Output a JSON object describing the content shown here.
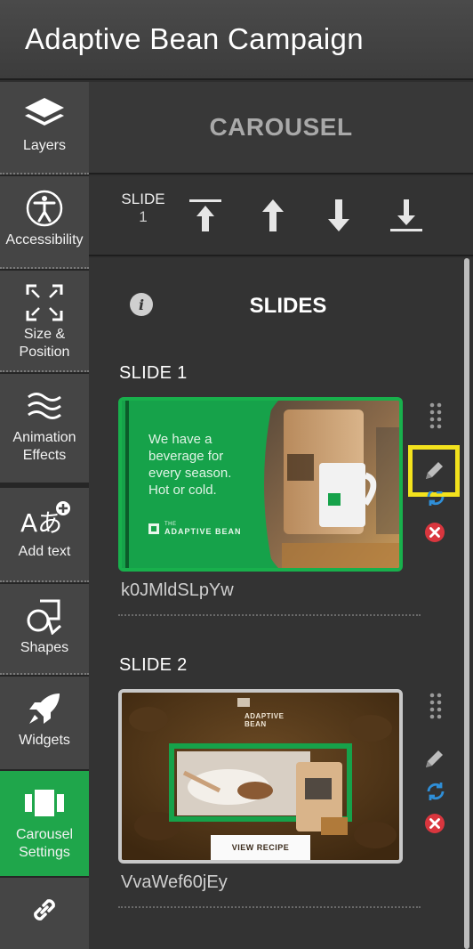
{
  "app": {
    "title": "Adaptive Bean Campaign"
  },
  "sidebar": {
    "items": [
      {
        "label": "Layers",
        "icon": "layers-icon"
      },
      {
        "label": "Accessibility",
        "icon": "accessibility-icon"
      },
      {
        "label": "Size & Position",
        "icon": "resize-icon"
      },
      {
        "label": "Animation Effects",
        "icon": "waves-icon"
      },
      {
        "label": "Add text",
        "icon": "add-text-icon"
      },
      {
        "label": "Shapes",
        "icon": "shapes-icon"
      },
      {
        "label": "Widgets",
        "icon": "rocket-icon"
      },
      {
        "label": "Carousel Settings",
        "icon": "carousel-icon"
      },
      {
        "label": "",
        "icon": "link-icon"
      }
    ]
  },
  "carousel": {
    "heading": "CAROUSEL",
    "slide_indicator": {
      "label": "SLIDE",
      "number": "1"
    }
  },
  "slides_panel": {
    "title": "SLIDES",
    "slides": [
      {
        "label": "SLIDE 1",
        "id": "k0JMldSLpYw",
        "thumb_text_lines": [
          "We have a",
          "beverage for",
          "every season.",
          "Hot or cold."
        ],
        "thumb_logo_small": "THE",
        "thumb_logo_big": "ADAPTIVE BEAN",
        "selected": true
      },
      {
        "label": "SLIDE 2",
        "id": "VvaWef60jEy",
        "thumb_button": "VIEW RECIPE",
        "thumb_logo": "ADAPTIVE BEAN",
        "selected": false
      }
    ]
  },
  "colors": {
    "accent": "#1fa64b",
    "highlight": "#f3e21d",
    "delete": "#d9363e",
    "refresh": "#2f8fd8"
  }
}
